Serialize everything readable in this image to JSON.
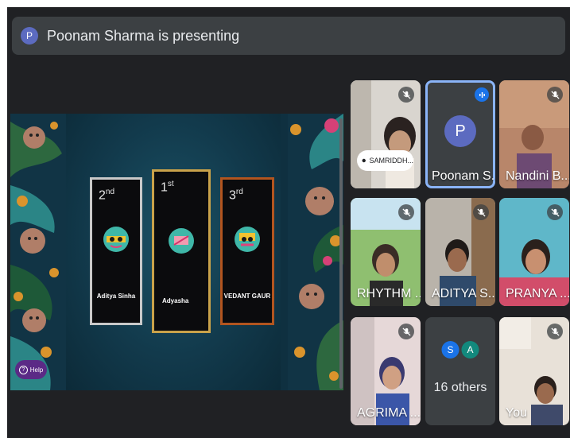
{
  "presentation_bar": {
    "avatar_letter": "P",
    "text": "Poonam Sharma is presenting"
  },
  "slide": {
    "cards": [
      {
        "rank_num": "2",
        "rank_suffix": "nd",
        "name": "Aditya Sinha",
        "border_color": "#c9c9c9"
      },
      {
        "rank_num": "1",
        "rank_suffix": "st",
        "name": "Adyasha",
        "border_color": "#c9a24a"
      },
      {
        "rank_num": "3",
        "rank_suffix": "rd",
        "name": "VEDANT GAUR",
        "border_color": "#b2551f"
      }
    ],
    "help_label": "Help"
  },
  "participants": [
    {
      "label": "SAMRIDDH...",
      "muted": true,
      "pill": true
    },
    {
      "label": "Poonam S...",
      "avatar_letter": "P",
      "speaking": true
    },
    {
      "label": "Nandini B...",
      "muted": true
    },
    {
      "label": "RHYTHM ...",
      "muted": true
    },
    {
      "label": "ADITYA S...",
      "muted": true
    },
    {
      "label": "PRANYA ...",
      "muted": true
    },
    {
      "label": "AGRIMA ...",
      "muted": true
    },
    {
      "others_text": "16 others",
      "avatars": [
        "S",
        "A"
      ]
    },
    {
      "label": "You",
      "muted": true
    }
  ],
  "colors": {
    "background": "#202124",
    "speaking_outline": "#8ab4f8",
    "avatar_purple": "#5c6bc0",
    "avatar_blue": "#1a73e8",
    "avatar_teal": "#12897d"
  }
}
